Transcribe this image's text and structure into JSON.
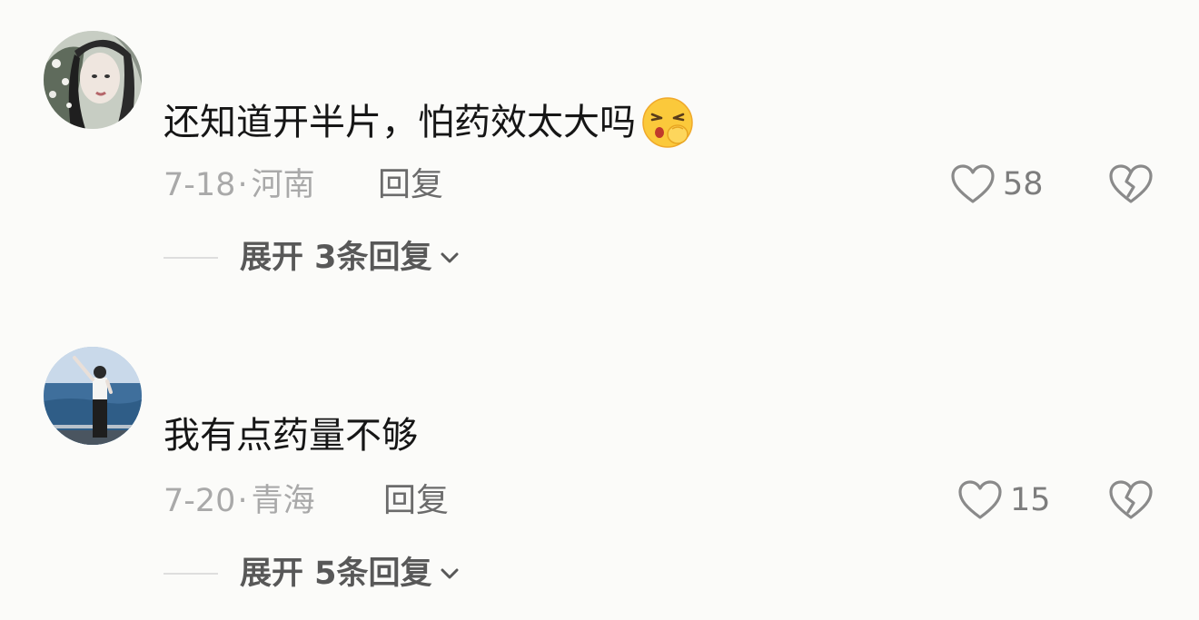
{
  "comments": [
    {
      "text": "还知道开半片，怕药效太大吗",
      "emoji": "shushing-face-emoji",
      "date": "7-18",
      "location": "河南",
      "reply_label": "回复",
      "likes": "58",
      "expand_label": "展开 3条回复"
    },
    {
      "text": "我有点药量不够",
      "date": "7-20",
      "location": "青海",
      "reply_label": "回复",
      "likes": "15",
      "expand_label": "展开 5条回复"
    }
  ],
  "separator": "·",
  "icons": {
    "like": "heart-outline-icon",
    "dislike": "broken-heart-icon",
    "chevron": "chevron-down-icon"
  },
  "colors": {
    "background": "#fbfbf9",
    "text": "#161616",
    "meta": "#a9a9a9",
    "secondary": "#6b6b6b"
  }
}
